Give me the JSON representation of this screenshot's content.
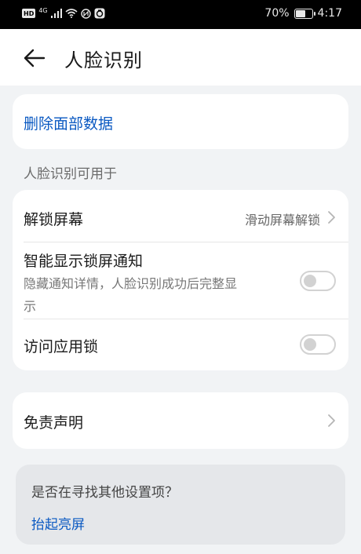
{
  "status_bar": {
    "network_labels": [
      "HD",
      "4G"
    ],
    "battery_percent": "70%",
    "battery_level": 0.7,
    "time": "4:17"
  },
  "header": {
    "title": "人脸识别"
  },
  "delete_card": {
    "label": "删除面部数据"
  },
  "section": {
    "label": "人脸识别可用于"
  },
  "options": {
    "unlock": {
      "title": "解锁屏幕",
      "value": "滑动屏幕解锁"
    },
    "smart_notify": {
      "title": "智能显示锁屏通知",
      "subtitle_line1": "隐藏通知详情，人脸识别成功后完整显",
      "subtitle_line2": "示",
      "enabled": false
    },
    "app_lock": {
      "title": "访问应用锁",
      "enabled": false
    }
  },
  "disclaimer": {
    "title": "免责声明"
  },
  "suggestion": {
    "question": "是否在寻找其他设置项？",
    "link": "抬起亮屏"
  },
  "colors": {
    "accent": "#0a59c2",
    "background": "#f1f3f5",
    "card": "#ffffff"
  }
}
